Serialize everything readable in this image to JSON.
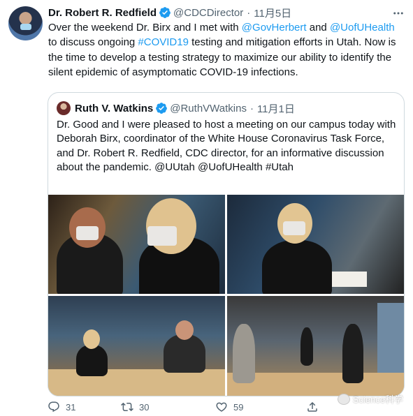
{
  "tweet": {
    "author_name": "Dr. Robert R. Redfield",
    "handle": "@CDCDirector",
    "separator": "·",
    "date": "11月5日",
    "text": {
      "p1": "Over the weekend Dr. Birx and I met with ",
      "mention1": "@GovHerbert",
      "p2": " and ",
      "mention2": "@UofUHealth",
      "p3": " to discuss ongoing ",
      "hashtag": "#COVID19",
      "p4": " testing and mitigation efforts in Utah.  Now is the time to develop a testing strategy to maximize our ability to identify the silent epidemic of asymptomatic COVID-19 infections."
    }
  },
  "quoted": {
    "author_name": "Ruth V. Watkins",
    "handle": "@RuthVWatkins",
    "separator": "·",
    "date": "11月1日",
    "text": "Dr. Good and I were pleased to host a meeting on our campus today with Deborah Birx, coordinator of the White House Coronavirus Task Force, and Dr. Robert R. Redfield, CDC director, for an informative discussion about the pandemic. @UUtah @UofUHealth #Utah"
  },
  "actions": {
    "reply_count": "31",
    "retweet_count": "30",
    "like_count": "59"
  },
  "watermark": {
    "label": "Science科学"
  },
  "colors": {
    "link": "#1d9bf0",
    "verified": "#1d9bf0",
    "muted": "#536471",
    "text": "#0f1419",
    "border": "#cfd9de"
  }
}
